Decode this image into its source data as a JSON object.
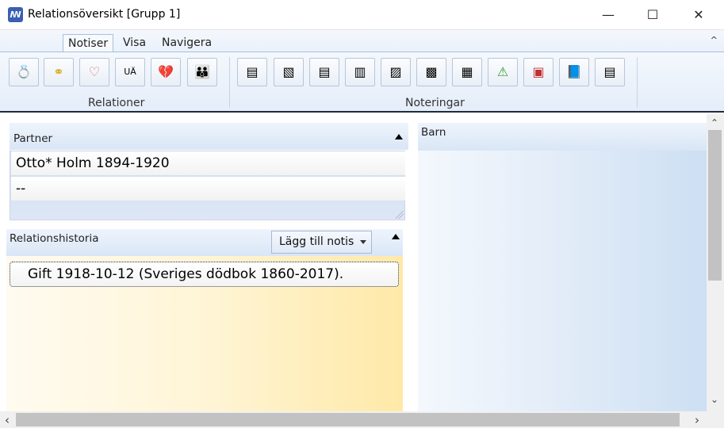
{
  "window": {
    "title": "Relationsöversikt [Grupp 1]",
    "app_icon_glyph": "ꟿ",
    "minimize_glyph": "—",
    "maximize_glyph": "☐",
    "close_glyph": "✕"
  },
  "tabs": [
    {
      "label": "Notiser",
      "active": true
    },
    {
      "label": "Visa",
      "active": false
    },
    {
      "label": "Navigera",
      "active": false
    }
  ],
  "ribbon_collapse_glyph": "^",
  "ribbon": {
    "group_relationer": "Relationer",
    "group_noteringar": "Noteringar",
    "relationer_buttons": [
      {
        "icon": "ring-icon",
        "glyph": "💍"
      },
      {
        "icon": "wedding-rings-icon",
        "glyph": "⚭"
      },
      {
        "icon": "heart-icon",
        "glyph": "♡"
      },
      {
        "icon": "ua-icon",
        "glyph": "UÄ"
      },
      {
        "icon": "broken-heart-icon",
        "glyph": "💔"
      },
      {
        "icon": "people-icon",
        "glyph": "👪"
      }
    ],
    "noteringar_buttons": [
      {
        "icon": "note-icon",
        "glyph": "▤"
      },
      {
        "icon": "note-x-icon",
        "glyph": "▧"
      },
      {
        "icon": "document-icon",
        "glyph": "▤"
      },
      {
        "icon": "document-alt-icon",
        "glyph": "▥"
      },
      {
        "icon": "image-icon",
        "glyph": "▨"
      },
      {
        "icon": "picture-icon",
        "glyph": "▩"
      },
      {
        "icon": "picture-x-icon",
        "glyph": "▦"
      },
      {
        "icon": "warning-icon",
        "glyph": "⚠"
      },
      {
        "icon": "note-bookmark-icon",
        "glyph": "▣"
      },
      {
        "icon": "book-icon",
        "glyph": "📘"
      },
      {
        "icon": "list-icon",
        "glyph": "▤"
      }
    ]
  },
  "partner": {
    "title": "Partner",
    "rows": [
      "Otto*  Holm 1894-1920",
      "--"
    ]
  },
  "history": {
    "title": "Relationshistoria",
    "add_note_label": "Lägg till notis",
    "items": [
      "Gift 1918-10-12 (Sveriges dödbok 1860-2017)."
    ]
  },
  "barn": {
    "title": "Barn"
  },
  "scroll": {
    "up": "⌃",
    "down": "⌄",
    "left": "‹",
    "right": "›"
  },
  "colors": {
    "ribbon_border": "#1f2b3b",
    "history_gradient_end": "#ffe9a8",
    "warning_icon": "#2e9d2e"
  }
}
